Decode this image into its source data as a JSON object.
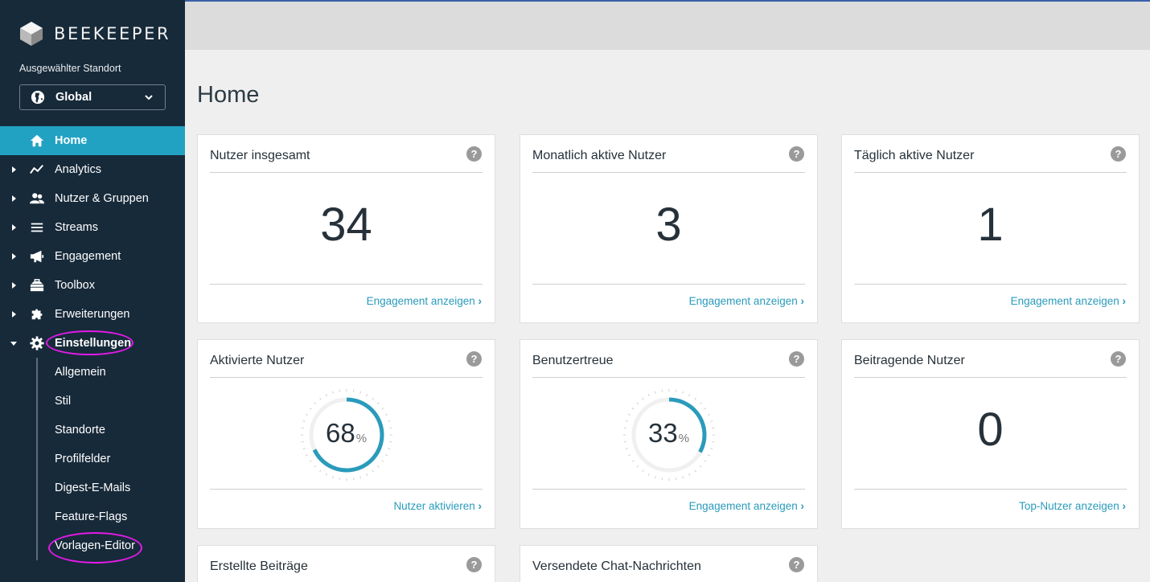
{
  "app": {
    "brand": "BEEKEEPER",
    "location_label": "Ausgewählter Standort",
    "location_value": "Global"
  },
  "nav": {
    "items": [
      {
        "label": "Home",
        "icon": "home-icon"
      },
      {
        "label": "Analytics",
        "icon": "analytics-icon"
      },
      {
        "label": "Nutzer & Gruppen",
        "icon": "users-icon"
      },
      {
        "label": "Streams",
        "icon": "streams-icon"
      },
      {
        "label": "Engagement",
        "icon": "megaphone-icon"
      },
      {
        "label": "Toolbox",
        "icon": "toolbox-icon"
      },
      {
        "label": "Erweiterungen",
        "icon": "puzzle-icon"
      },
      {
        "label": "Einstellungen",
        "icon": "gear-icon"
      }
    ],
    "settings_sub": [
      "Allgemein",
      "Stil",
      "Standorte",
      "Profilfelder",
      "Digest-E-Mails",
      "Feature-Flags",
      "Vorlagen-Editor"
    ]
  },
  "page": {
    "title": "Home"
  },
  "cards": [
    {
      "title": "Nutzer insgesamt",
      "value": "34",
      "link": "Engagement anzeigen"
    },
    {
      "title": "Monatlich aktive Nutzer",
      "value": "3",
      "link": "Engagement anzeigen"
    },
    {
      "title": "Täglich aktive Nutzer",
      "value": "1",
      "link": "Engagement anzeigen"
    },
    {
      "title": "Aktivierte Nutzer",
      "value": "68",
      "unit": "%",
      "progress": 0.68,
      "link": "Nutzer aktivieren"
    },
    {
      "title": "Benutzertreue",
      "value": "33",
      "unit": "%",
      "progress": 0.33,
      "link": "Engagement anzeigen"
    },
    {
      "title": "Beitragende Nutzer",
      "value": "0",
      "link": "Top-Nutzer anzeigen"
    },
    {
      "title": "Erstellte Beiträge"
    },
    {
      "title": "Versendete Chat-Nachrichten"
    }
  ],
  "colors": {
    "sidebar": "#172a3a",
    "accent": "#22a2c3",
    "link": "#2a9bbb",
    "highlight_circle": "#e31ae8"
  }
}
